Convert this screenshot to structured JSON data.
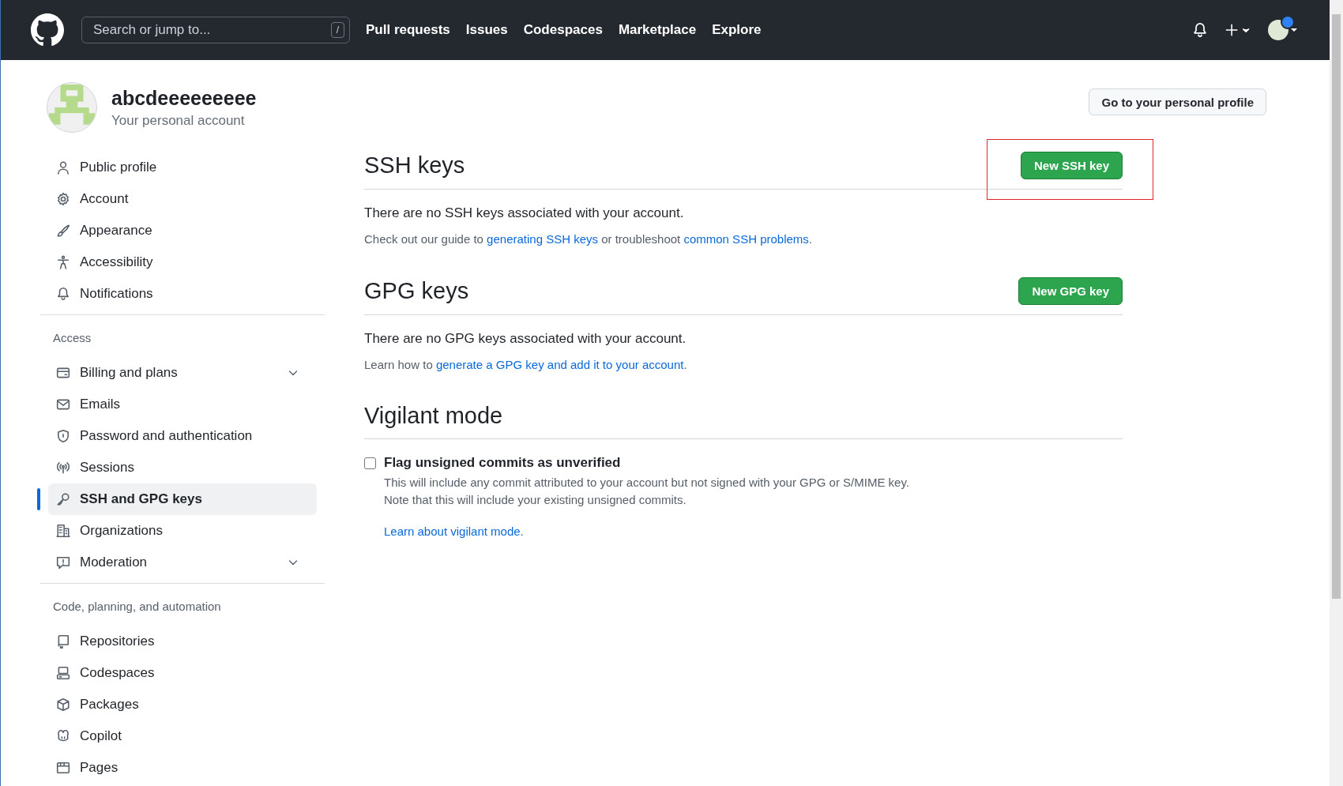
{
  "header": {
    "search": {
      "placeholder": "Search or jump to..."
    },
    "search_key": "/",
    "nav": [
      "Pull requests",
      "Issues",
      "Codespaces",
      "Marketplace",
      "Explore"
    ]
  },
  "account": {
    "name": "abcdeeeeeeeee",
    "subtitle": "Your personal account",
    "profile_button": "Go to your personal profile"
  },
  "sidebar": {
    "groups": [
      {
        "items": [
          {
            "label": "Public profile",
            "kind": "link",
            "selected": false
          },
          {
            "label": "Account",
            "kind": "link",
            "selected": false
          },
          {
            "label": "Appearance",
            "kind": "link",
            "selected": false
          },
          {
            "label": "Accessibility",
            "kind": "link",
            "selected": false
          },
          {
            "label": "Notifications",
            "kind": "link",
            "selected": false
          }
        ]
      },
      {
        "heading": "Access",
        "items": [
          {
            "label": "Billing and plans",
            "kind": "menu",
            "selected": false
          },
          {
            "label": "Emails",
            "kind": "link",
            "selected": false
          },
          {
            "label": "Password and authentication",
            "kind": "link",
            "selected": false
          },
          {
            "label": "Sessions",
            "kind": "link",
            "selected": false
          },
          {
            "label": "SSH and GPG keys",
            "kind": "link",
            "selected": true
          },
          {
            "label": "Organizations",
            "kind": "link",
            "selected": false
          },
          {
            "label": "Moderation",
            "kind": "menu",
            "selected": false
          }
        ]
      },
      {
        "heading": "Code, planning, and automation",
        "items": [
          {
            "label": "Repositories",
            "kind": "link",
            "selected": false
          },
          {
            "label": "Codespaces",
            "kind": "link",
            "selected": false
          },
          {
            "label": "Packages",
            "kind": "link",
            "selected": false
          },
          {
            "label": "Copilot",
            "kind": "link",
            "selected": false
          },
          {
            "label": "Pages",
            "kind": "link",
            "selected": false
          }
        ]
      }
    ]
  },
  "sections": [
    {
      "title": "SSH keys",
      "button": "New SSH key",
      "highlighted": true,
      "empty": "There are no SSH keys associated with your account.",
      "help": [
        {
          "text": "Check out our guide to "
        },
        {
          "link": "generating SSH keys"
        },
        {
          "text": " or troubleshoot "
        },
        {
          "link": "common SSH problems"
        },
        {
          "text": "."
        }
      ]
    },
    {
      "title": "GPG keys",
      "button": "New GPG key",
      "highlighted": false,
      "empty": "There are no GPG keys associated with your account.",
      "help": [
        {
          "text": "Learn how to "
        },
        {
          "link": "generate a GPG key and add it to your account"
        },
        {
          "text": "."
        }
      ]
    }
  ],
  "vigilant": {
    "title": "Vigilant mode",
    "checkbox": {
      "label": "Flag unsigned commits as unverified",
      "checked": false
    },
    "description": [
      "This will include any commit attributed to your account but not signed with your GPG or S/MIME key.",
      "Note that this will include your existing unsigned commits."
    ],
    "link": "Learn about vigilant mode."
  }
}
